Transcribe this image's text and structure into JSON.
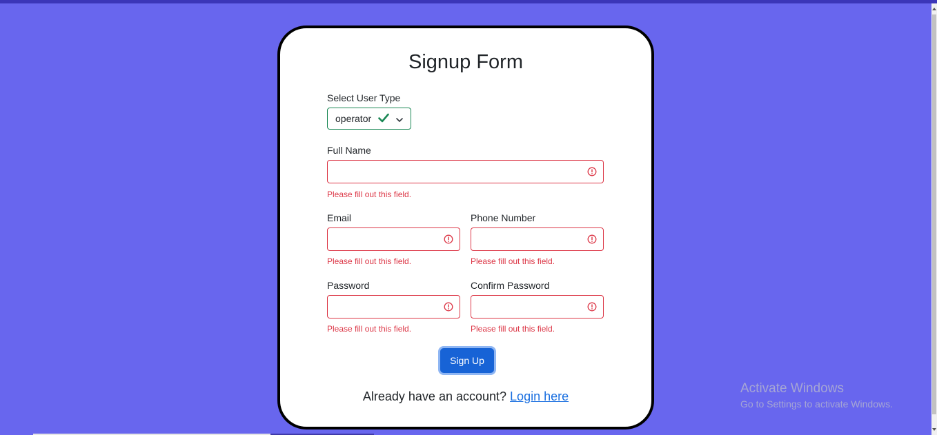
{
  "form": {
    "title": "Signup Form",
    "user_type": {
      "label": "Select User Type",
      "value": "operator"
    },
    "full_name": {
      "label": "Full Name",
      "value": "",
      "error": "Please fill out this field."
    },
    "email": {
      "label": "Email",
      "value": "",
      "error": "Please fill out this field."
    },
    "phone": {
      "label": "Phone Number",
      "value": "",
      "error": "Please fill out this field."
    },
    "password": {
      "label": "Password",
      "value": "",
      "error": "Please fill out this field."
    },
    "confirm_password": {
      "label": "Confirm Password",
      "value": "",
      "error": "Please fill out this field."
    },
    "submit_label": "Sign Up",
    "footer_text": "Already have an account?",
    "login_link": "Login here"
  },
  "watermark": {
    "line1": "Activate Windows",
    "line2": "Go to Settings to activate Windows."
  },
  "colors": {
    "background": "#6866ee",
    "error": "#dc3545",
    "valid": "#198754",
    "button": "#1763d6",
    "link": "#1a6fe0"
  },
  "icons": {
    "valid": "check-icon",
    "invalid": "exclamation-circle-icon",
    "dropdown": "chevron-down-icon"
  }
}
